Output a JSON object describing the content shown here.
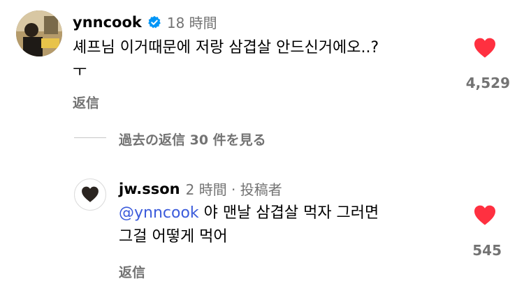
{
  "comment": {
    "username": "ynncook",
    "time": "18 時間",
    "text_line1": "셰프님 이거때문에 저랑 삼겹살 안드신거에오..?",
    "text_line2": "ㅜ",
    "reply_label": "返信",
    "likes": "4,529",
    "verified": true
  },
  "view_replies": "過去の返信 30 件を見る",
  "reply": {
    "username": "jw.sson",
    "time": "2 時間 · 投稿者",
    "mention": "@ynncook",
    "text_line1_rest": " 야 맨날 삼겹살 먹자 그러면",
    "text_line2": "그걸 어떻게 먹어",
    "reply_label": "返信",
    "likes": "545"
  },
  "colors": {
    "heart": "#ff3040",
    "verified": "#0095f6",
    "mention": "#3b5bdb",
    "secondary": "#737373"
  }
}
